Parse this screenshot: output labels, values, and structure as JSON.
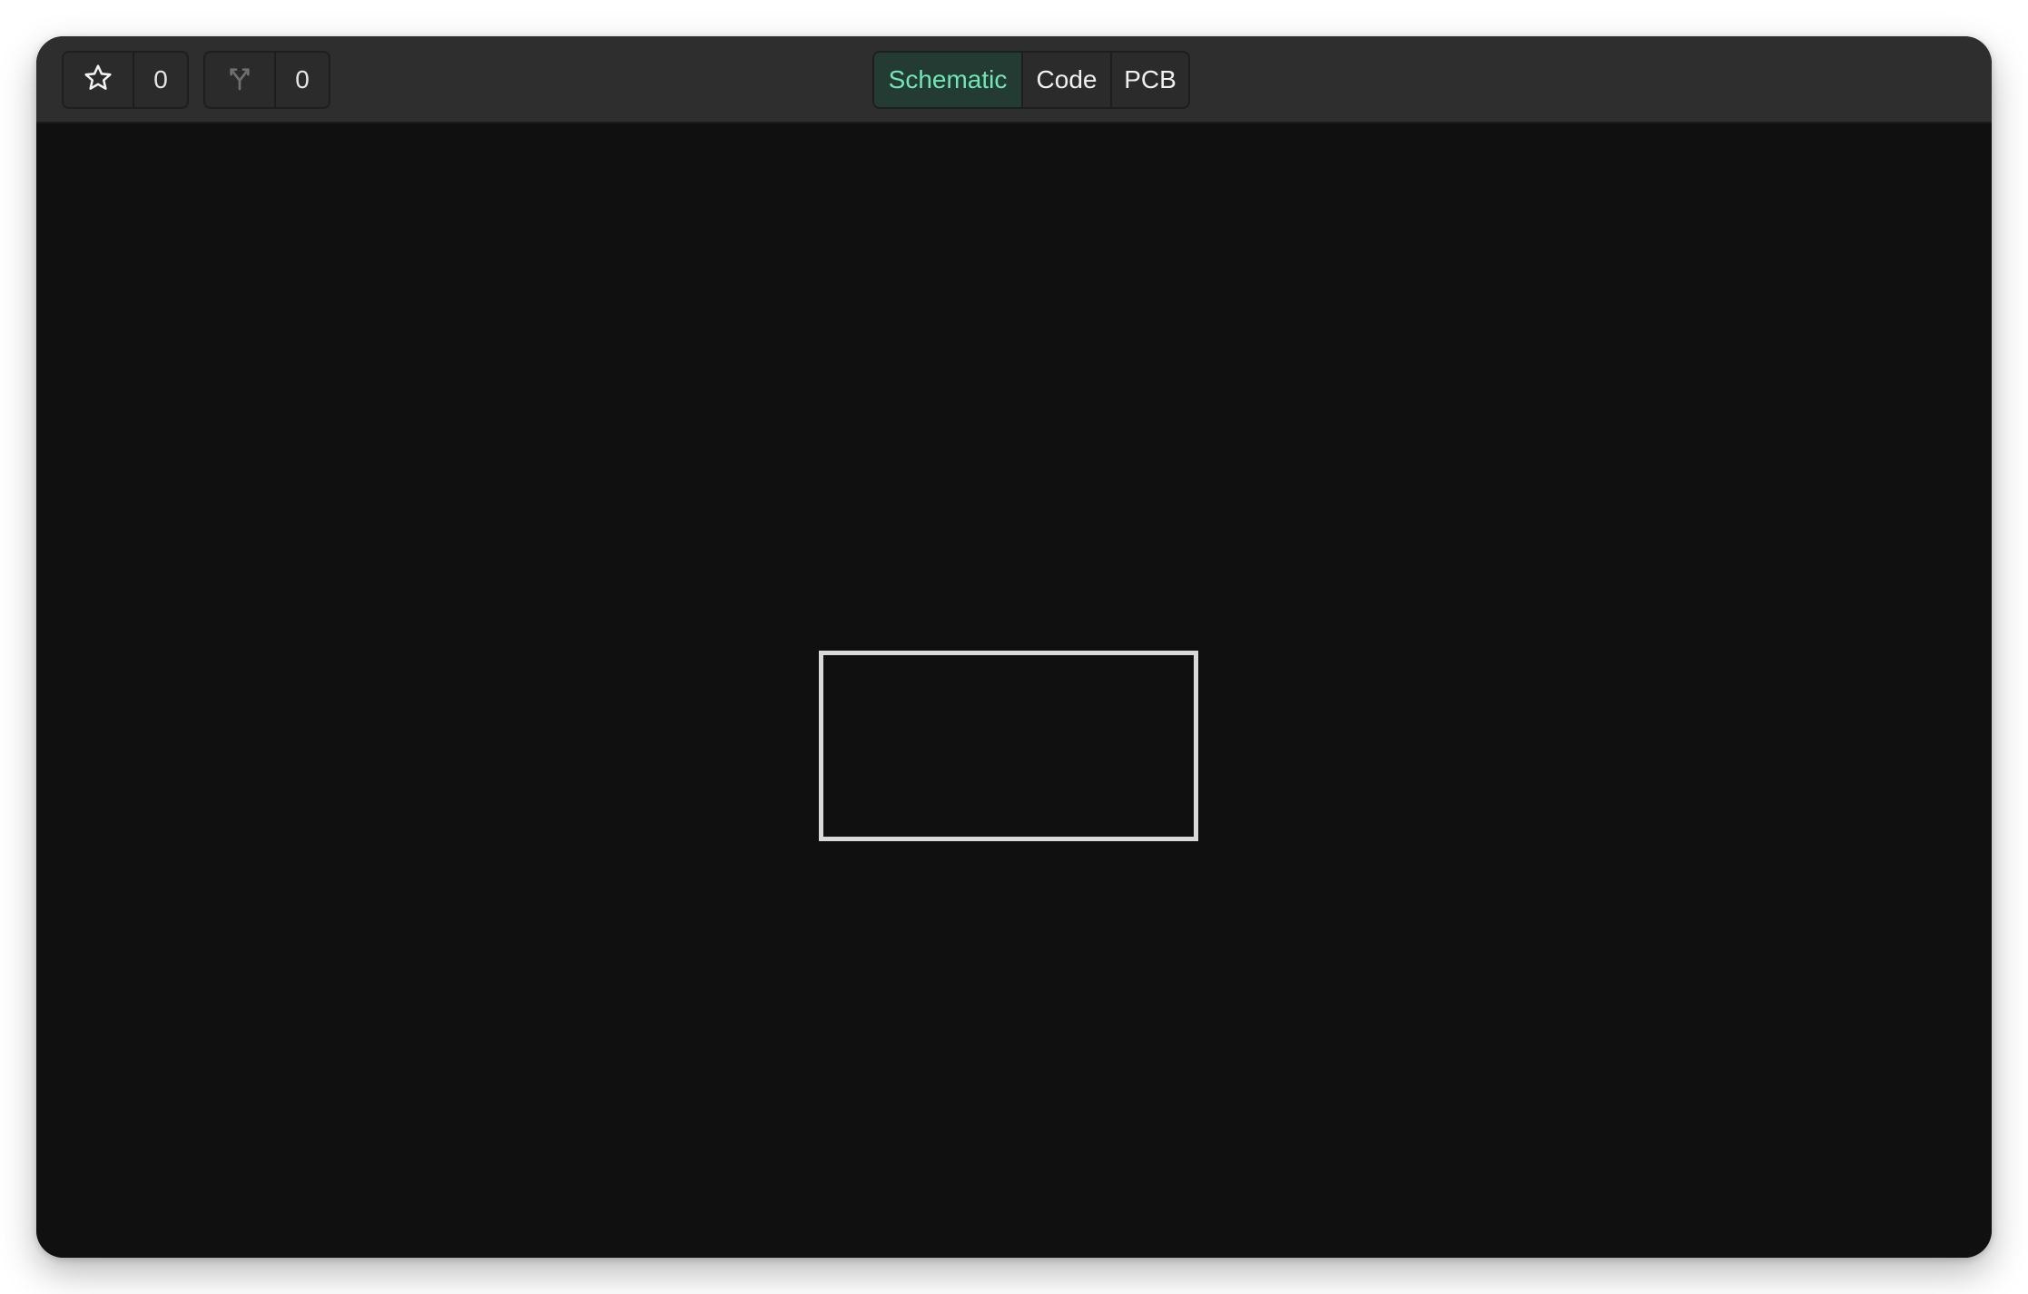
{
  "toolbar": {
    "star": {
      "icon": "star-outline-icon",
      "count": "0"
    },
    "fork": {
      "icon": "fork-icon",
      "count": "0"
    },
    "tabs": [
      {
        "label": "Schematic",
        "active": true
      },
      {
        "label": "Code",
        "active": false
      },
      {
        "label": "PCB",
        "active": false
      }
    ]
  },
  "colors": {
    "toolbar_bg": "#2e2e2e",
    "canvas_bg": "#101010",
    "active_tab_text": "#6ee7b7",
    "active_tab_bg": "#243b33",
    "component_outline": "#d9d9d9"
  }
}
